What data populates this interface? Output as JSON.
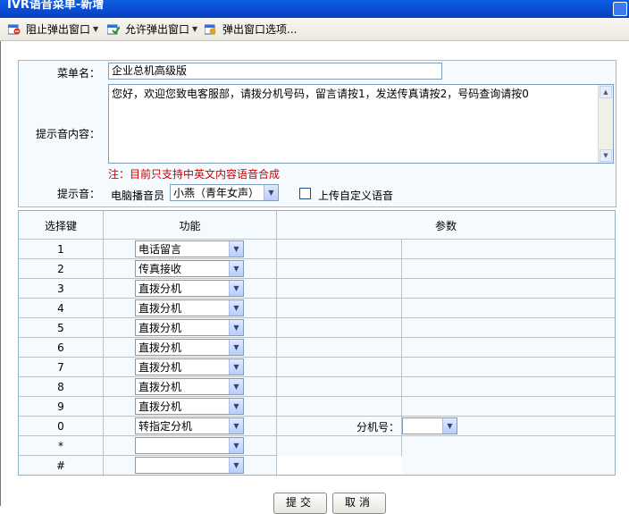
{
  "window": {
    "title": "IVR语音菜单-新增"
  },
  "popup_bar": {
    "block_label": "阻止弹出窗口",
    "allow_label": "允许弹出窗口",
    "options_label": "弹出窗口选项..."
  },
  "form": {
    "menu_name_label": "菜单名：",
    "menu_name_value": "企业总机高级版",
    "prompt_content_label": "提示音内容：",
    "prompt_content_value": "您好，欢迎您致电客服部，请拨分机号码，留言请按1，发送传真请按2，号码查询请按0",
    "note": "注：目前只支持中英文内容语音合成",
    "prompt_label": "提示音：",
    "announcer_label": "电脑播音员",
    "voice_value": "小燕（青年女声）",
    "upload_label": "上传自定义语音"
  },
  "table": {
    "headers": {
      "key": "选择键",
      "function": "功能",
      "params": "参数"
    },
    "rows": [
      {
        "key": "1",
        "function": "电话留言"
      },
      {
        "key": "2",
        "function": "传真接收"
      },
      {
        "key": "3",
        "function": "直拨分机"
      },
      {
        "key": "4",
        "function": "直拨分机"
      },
      {
        "key": "5",
        "function": "直拨分机"
      },
      {
        "key": "6",
        "function": "直拨分机"
      },
      {
        "key": "7",
        "function": "直拨分机"
      },
      {
        "key": "8",
        "function": "直拨分机"
      },
      {
        "key": "9",
        "function": "直拨分机"
      },
      {
        "key": "0",
        "function": "转指定分机"
      },
      {
        "key": "*",
        "function": ""
      },
      {
        "key": "#",
        "function": ""
      }
    ],
    "extension_label": "分机号：",
    "extension_value": ""
  },
  "actions": {
    "submit": "提交",
    "cancel": "取消"
  }
}
